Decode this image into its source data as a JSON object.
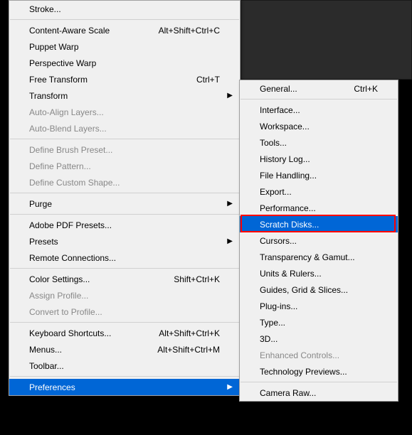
{
  "left_menu": [
    {
      "label": "Stroke...",
      "shortcut": "",
      "disabled": false,
      "arrow": false
    },
    {
      "sep": true
    },
    {
      "label": "Content-Aware Scale",
      "shortcut": "Alt+Shift+Ctrl+C",
      "disabled": false,
      "arrow": false
    },
    {
      "label": "Puppet Warp",
      "shortcut": "",
      "disabled": false,
      "arrow": false
    },
    {
      "label": "Perspective Warp",
      "shortcut": "",
      "disabled": false,
      "arrow": false
    },
    {
      "label": "Free Transform",
      "shortcut": "Ctrl+T",
      "disabled": false,
      "arrow": false
    },
    {
      "label": "Transform",
      "shortcut": "",
      "disabled": false,
      "arrow": true
    },
    {
      "label": "Auto-Align Layers...",
      "shortcut": "",
      "disabled": true,
      "arrow": false
    },
    {
      "label": "Auto-Blend Layers...",
      "shortcut": "",
      "disabled": true,
      "arrow": false
    },
    {
      "sep": true
    },
    {
      "label": "Define Brush Preset...",
      "shortcut": "",
      "disabled": true,
      "arrow": false
    },
    {
      "label": "Define Pattern...",
      "shortcut": "",
      "disabled": true,
      "arrow": false
    },
    {
      "label": "Define Custom Shape...",
      "shortcut": "",
      "disabled": true,
      "arrow": false
    },
    {
      "sep": true
    },
    {
      "label": "Purge",
      "shortcut": "",
      "disabled": false,
      "arrow": true
    },
    {
      "sep": true
    },
    {
      "label": "Adobe PDF Presets...",
      "shortcut": "",
      "disabled": false,
      "arrow": false
    },
    {
      "label": "Presets",
      "shortcut": "",
      "disabled": false,
      "arrow": true
    },
    {
      "label": "Remote Connections...",
      "shortcut": "",
      "disabled": false,
      "arrow": false
    },
    {
      "sep": true
    },
    {
      "label": "Color Settings...",
      "shortcut": "Shift+Ctrl+K",
      "disabled": false,
      "arrow": false
    },
    {
      "label": "Assign Profile...",
      "shortcut": "",
      "disabled": true,
      "arrow": false
    },
    {
      "label": "Convert to Profile...",
      "shortcut": "",
      "disabled": true,
      "arrow": false
    },
    {
      "sep": true
    },
    {
      "label": "Keyboard Shortcuts...",
      "shortcut": "Alt+Shift+Ctrl+K",
      "disabled": false,
      "arrow": false
    },
    {
      "label": "Menus...",
      "shortcut": "Alt+Shift+Ctrl+M",
      "disabled": false,
      "arrow": false
    },
    {
      "label": "Toolbar...",
      "shortcut": "",
      "disabled": false,
      "arrow": false
    },
    {
      "sep": true
    },
    {
      "label": "Preferences",
      "shortcut": "",
      "disabled": false,
      "arrow": true,
      "selected": true
    }
  ],
  "right_menu": [
    {
      "label": "General...",
      "shortcut": "Ctrl+K"
    },
    {
      "sep": true
    },
    {
      "label": "Interface..."
    },
    {
      "label": "Workspace..."
    },
    {
      "label": "Tools..."
    },
    {
      "label": "History Log..."
    },
    {
      "label": "File Handling..."
    },
    {
      "label": "Export..."
    },
    {
      "label": "Performance..."
    },
    {
      "label": "Scratch Disks...",
      "selected": true,
      "highlighted": true
    },
    {
      "label": "Cursors..."
    },
    {
      "label": "Transparency & Gamut..."
    },
    {
      "label": "Units & Rulers..."
    },
    {
      "label": "Guides, Grid & Slices..."
    },
    {
      "label": "Plug-ins..."
    },
    {
      "label": "Type..."
    },
    {
      "label": "3D..."
    },
    {
      "label": "Enhanced Controls...",
      "disabled": true
    },
    {
      "label": "Technology Previews..."
    },
    {
      "sep": true
    },
    {
      "label": "Camera Raw..."
    }
  ]
}
